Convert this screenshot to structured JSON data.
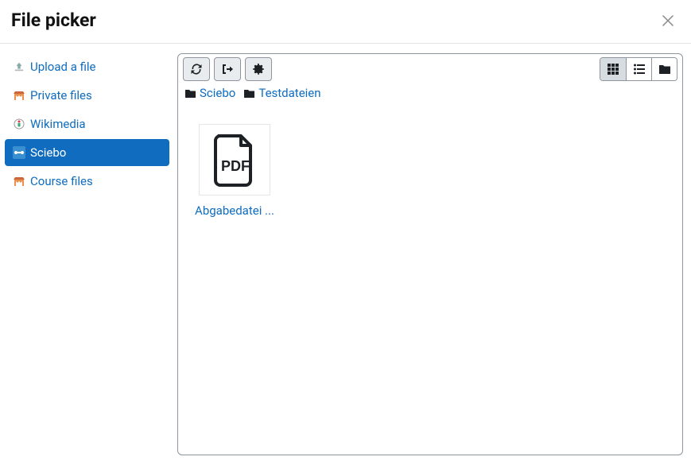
{
  "header": {
    "title": "File picker"
  },
  "repos": [
    {
      "label": "Upload a file",
      "icon": "upload",
      "active": false
    },
    {
      "label": "Private files",
      "icon": "moodle",
      "active": false
    },
    {
      "label": "Wikimedia",
      "icon": "wikimedia",
      "active": false
    },
    {
      "label": "Sciebo",
      "icon": "sciebo",
      "active": true
    },
    {
      "label": "Course files",
      "icon": "moodle",
      "active": false
    }
  ],
  "breadcrumb": [
    {
      "label": "Sciebo"
    },
    {
      "label": "Testdateien"
    }
  ],
  "files": [
    {
      "name": "Abgabedatei ...",
      "type": "pdf"
    }
  ]
}
